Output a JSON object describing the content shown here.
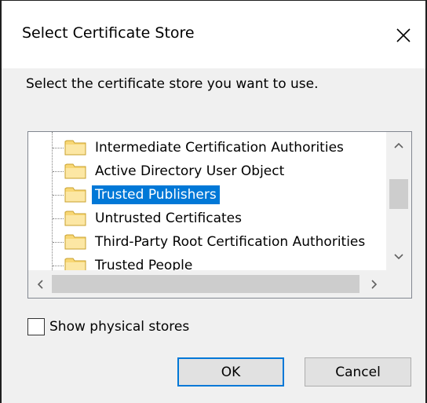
{
  "dialog": {
    "title": "Select Certificate Store",
    "prompt": "Select the certificate store you want to use.",
    "tree": {
      "items": [
        {
          "label": "Intermediate Certification Authorities",
          "icon": "folder-icon",
          "selected": false
        },
        {
          "label": "Active Directory User Object",
          "icon": "folder-icon",
          "selected": false
        },
        {
          "label": "Trusted Publishers",
          "icon": "folder-icon",
          "selected": true
        },
        {
          "label": "Untrusted Certificates",
          "icon": "folder-icon",
          "selected": false
        },
        {
          "label": "Third-Party Root Certification Authorities",
          "icon": "folder-icon",
          "selected": false
        },
        {
          "label": "Trusted People",
          "icon": "folder-icon",
          "selected": false
        }
      ]
    },
    "show_physical_stores": {
      "label": "Show physical stores",
      "checked": false
    },
    "buttons": {
      "ok_label": "OK",
      "cancel_label": "Cancel"
    }
  },
  "colors": {
    "selection": "#0078d7",
    "button_face": "#e1e1e1",
    "dialog_bg": "#f0f0f0"
  }
}
